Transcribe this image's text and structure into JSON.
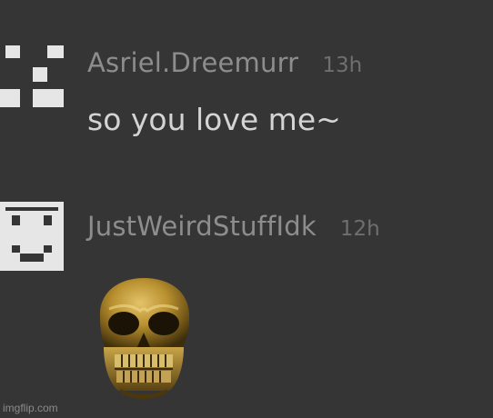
{
  "comments": [
    {
      "username": "Asriel.Dreemurr",
      "time": "13h",
      "message": "so you love me~",
      "avatar_icon": "pixel-face-icon"
    },
    {
      "username": "JustWeirdStuffIdk",
      "time": "12h",
      "message": "",
      "avatar_icon": "pixel-face-icon",
      "sticker_icon": "golden-skull-icon"
    }
  ],
  "watermark": "imgflip.com",
  "colors": {
    "background": "#353535",
    "username": "#8d8d8d",
    "timestamp": "#6f6f6f",
    "message": "#d4d4d4",
    "avatar": "#e6e6e6"
  }
}
